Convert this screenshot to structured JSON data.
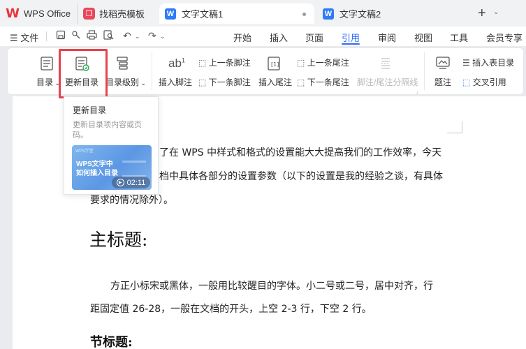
{
  "tabs": {
    "logo_label": "WPS Office",
    "template_label": "找稻壳模板",
    "doc1_label": "文字文稿1",
    "doc2_label": "文字文稿2",
    "new_tab_glyph": "+",
    "accent": "#2f6df6",
    "brand_red": "#e8343a"
  },
  "menubar": {
    "file_label": "文件",
    "tabs": [
      "开始",
      "插入",
      "页面",
      "引用",
      "审阅",
      "视图",
      "工具",
      "会员专享"
    ],
    "active_tab": "引用"
  },
  "ribbon": {
    "toc_label": "目录",
    "update_toc_label": "更新目录",
    "toc_level_label": "目录级别",
    "insert_footnote_label": "插入脚注",
    "prev_footnote_label": "上一条脚注",
    "next_footnote_label": "下一条脚注",
    "insert_endnote_label": "插入尾注",
    "prev_endnote_label": "上一条尾注",
    "next_endnote_label": "下一条尾注",
    "footnote_separator_label": "脚注/尾注分隔线",
    "caption_label": "题注",
    "insert_table_of_figures_label": "插入表目录",
    "cross_reference_label": "交叉引用"
  },
  "tooltip": {
    "title": "更新目录",
    "description": "更新目录项内容或页码。",
    "video_small_text": "WPS学堂",
    "video_title_line1": "WPS文字中",
    "video_title_line2": "如何插入目录",
    "video_duration": "02:11"
  },
  "document": {
    "para1_line1": "了在 WPS 中样式和格式的设置能大大提高我们的工作效率，今天",
    "para1_line2": "档中具体各部分的设置参数（以下的设置是我的经验之谈，有具体",
    "para1_line3": "要求的情况除外）。",
    "heading1": "主标题:",
    "para2_line1": "方正小标宋或黑体，一般用比较醒目的字体。小二号或二号，居中对齐，行",
    "para2_line2": "距固定值 26-28，一般在文档的开头，上空 2-3 行，下空 2 行。",
    "heading2": "节标题:"
  }
}
